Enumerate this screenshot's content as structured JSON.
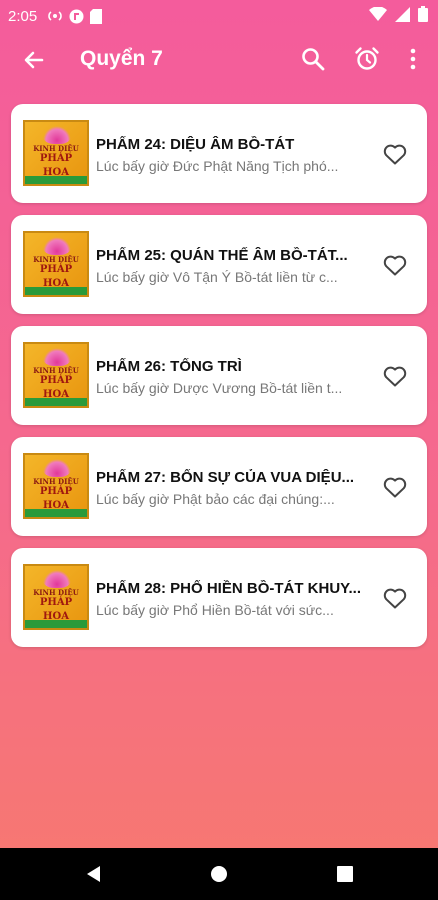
{
  "status_bar": {
    "time": "2:05",
    "left_icons": [
      "broadcast-icon",
      "app-icon",
      "sd-card-icon"
    ],
    "right_icons": [
      "wifi-icon",
      "signal-icon",
      "battery-icon"
    ]
  },
  "app_bar": {
    "title": "Quyển 7",
    "actions": [
      "back-icon",
      "search-icon",
      "alarm-icon",
      "more-vert-icon"
    ]
  },
  "thumbnail": {
    "line1": "KINH DIỆU",
    "line2": "PHÁP",
    "line3": "HOA"
  },
  "chapters": [
    {
      "title": "PHẨM 24: DIỆU ÂM BỒ-TÁT",
      "subtitle": "Lúc bấy giờ Đức Phật Năng Tịch phó..."
    },
    {
      "title": "PHẨM 25: QUÁN THẾ ÂM BỒ-TÁT...",
      "subtitle": "Lúc bấy giờ Vô Tận Ý Bồ-tát liền từ c..."
    },
    {
      "title": "PHẨM 26: TỔNG TRÌ",
      "subtitle": "Lúc bấy giờ Dược Vương Bồ-tát liền t..."
    },
    {
      "title": "PHẨM 27: BỔN SỰ CỦA VUA DIỆU...",
      "subtitle": "Lúc bấy giờ Phật bảo các đại chúng:..."
    },
    {
      "title": "PHẨM 28: PHỔ HIỀN BỒ-TÁT KHUY...",
      "subtitle": "Lúc bấy giờ Phổ Hiền Bồ-tát với sức..."
    }
  ],
  "colors": {
    "gradient_top": "#f45c9c",
    "gradient_bottom": "#f7796f",
    "card": "#ffffff",
    "title_text": "#111111",
    "subtitle_text": "#777777"
  },
  "nav_bar": {
    "buttons": [
      "back-triangle-icon",
      "home-circle-icon",
      "recents-square-icon"
    ]
  }
}
